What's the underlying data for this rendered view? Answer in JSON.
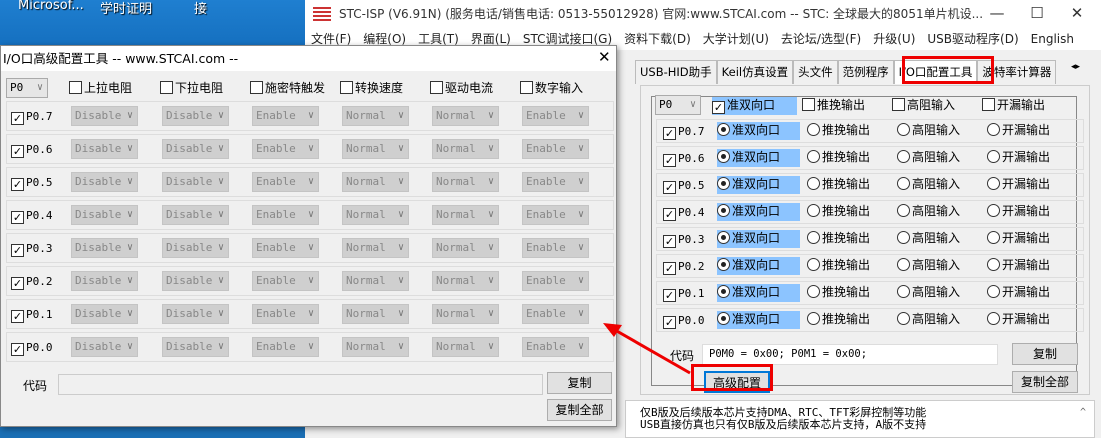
{
  "desktop": {
    "icons": [
      "Microsof...",
      "学时证明",
      "接"
    ]
  },
  "main_window": {
    "title": "STC-ISP (V6.91N) (服务电话/销售电话: 0513-55012928) 官网:www.STCAI.com  -- STC: 全球最大的8051单片机设...",
    "menu": [
      "文件(F)",
      "编程(O)",
      "工具(T)",
      "界面(L)",
      "STC调试接口(G)",
      "资料下载(D)",
      "大学计划(U)",
      "去论坛/选型(F)",
      "升级(U)",
      "USB驱动程序(D)",
      "English"
    ],
    "tabs": [
      "USB-HID助手",
      "Keil仿真设置",
      "头文件",
      "范例程序",
      "I/O口配置工具",
      "波特率计算器"
    ],
    "active_tab": "I/O口配置工具",
    "port_select": "P0",
    "header_options": [
      "准双向口",
      "推挽输出",
      "高阻输入",
      "开漏输出"
    ],
    "pins": [
      "P0.7",
      "P0.6",
      "P0.5",
      "P0.4",
      "P0.3",
      "P0.2",
      "P0.1",
      "P0.0"
    ],
    "code_label": "代码",
    "code_value": "P0M0 = 0x00; P0M1 = 0x00;",
    "copy_label": "复制",
    "copy_all_label": "复制全部",
    "advanced_label": "高级配置",
    "messages": [
      "仅B版及后续版本芯片支持DMA、RTC、TFT彩屏控制等功能",
      "USB直接仿真也只有仅B版及后续版本芯片支持，A版不支持"
    ]
  },
  "dialog": {
    "title": "I/O口高级配置工具 -- www.STCAI.com --",
    "port_select": "P0",
    "columns": [
      "上拉电阻",
      "下拉电阻",
      "施密特触发",
      "转换速度",
      "驱动电流",
      "数字输入"
    ],
    "pins": [
      "P0.7",
      "P0.6",
      "P0.5",
      "P0.4",
      "P0.3",
      "P0.2",
      "P0.1",
      "P0.0"
    ],
    "values": [
      "Disable",
      "Disable",
      "Enable",
      "Normal",
      "Normal",
      "Enable"
    ],
    "code_label": "代码",
    "code_value": "",
    "copy_label": "复制",
    "copy_all_label": "复制全部"
  },
  "colors": {
    "highlight": "#8cc4ff",
    "annotation": "#e00000"
  }
}
